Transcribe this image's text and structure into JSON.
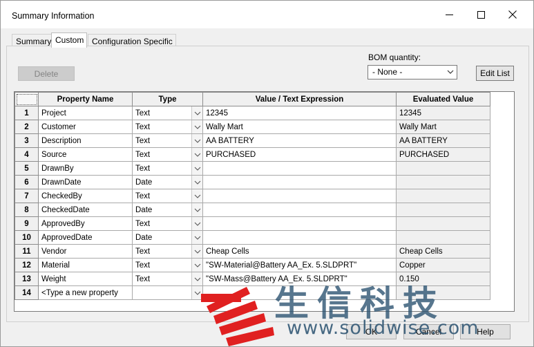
{
  "window": {
    "title": "Summary Information"
  },
  "tabs": [
    "Summary",
    "Custom",
    "Configuration Specific"
  ],
  "toolbar": {
    "delete_label": "Delete",
    "bom_label": "BOM quantity:",
    "bom_value": "- None -",
    "edit_list_label": "Edit List"
  },
  "grid": {
    "headers": [
      "Property Name",
      "Type",
      "Value / Text Expression",
      "Evaluated Value"
    ],
    "rows": [
      {
        "num": "1",
        "name": "Project",
        "type": "Text",
        "value": "12345",
        "evaluated": "12345"
      },
      {
        "num": "2",
        "name": "Customer",
        "type": "Text",
        "value": "Wally Mart",
        "evaluated": "Wally Mart"
      },
      {
        "num": "3",
        "name": "Description",
        "type": "Text",
        "value": "AA BATTERY",
        "evaluated": "AA BATTERY"
      },
      {
        "num": "4",
        "name": "Source",
        "type": "Text",
        "value": "PURCHASED",
        "evaluated": "PURCHASED"
      },
      {
        "num": "5",
        "name": "DrawnBy",
        "type": "Text",
        "value": "",
        "evaluated": ""
      },
      {
        "num": "6",
        "name": "DrawnDate",
        "type": "Date",
        "value": "",
        "evaluated": ""
      },
      {
        "num": "7",
        "name": "CheckedBy",
        "type": "Text",
        "value": "",
        "evaluated": ""
      },
      {
        "num": "8",
        "name": "CheckedDate",
        "type": "Date",
        "value": "",
        "evaluated": ""
      },
      {
        "num": "9",
        "name": "ApprovedBy",
        "type": "Text",
        "value": "",
        "evaluated": ""
      },
      {
        "num": "10",
        "name": "ApprovedDate",
        "type": "Date",
        "value": "",
        "evaluated": ""
      },
      {
        "num": "11",
        "name": "Vendor",
        "type": "Text",
        "value": "Cheap Cells",
        "evaluated": "Cheap Cells"
      },
      {
        "num": "12",
        "name": "Material",
        "type": "Text",
        "value": "\"SW-Material@Battery AA_Ex. 5.SLDPRT\"",
        "evaluated": "Copper"
      },
      {
        "num": "13",
        "name": "Weight",
        "type": "Text",
        "value": "\"SW-Mass@Battery AA_Ex. 5.SLDPRT\"",
        "evaluated": "0.150"
      },
      {
        "num": "14",
        "name": "<Type a new property",
        "type": "",
        "value": "",
        "evaluated": ""
      }
    ]
  },
  "footer": {
    "ok_label": "OK",
    "cancel_label": "Cancel",
    "help_label": "Help"
  },
  "watermark": {
    "text_cn": "生信科技",
    "url": "www.solidwise.com"
  },
  "colors": {
    "watermark_red": "#e02020",
    "watermark_text": "#2e5570",
    "title_bg": "#ffffff",
    "dialog_bg": "#f0f0f0"
  },
  "icons": {
    "minimize": "minimize-icon",
    "maximize": "maximize-icon",
    "close": "close-icon",
    "dropdown": "chevron-down-icon"
  }
}
